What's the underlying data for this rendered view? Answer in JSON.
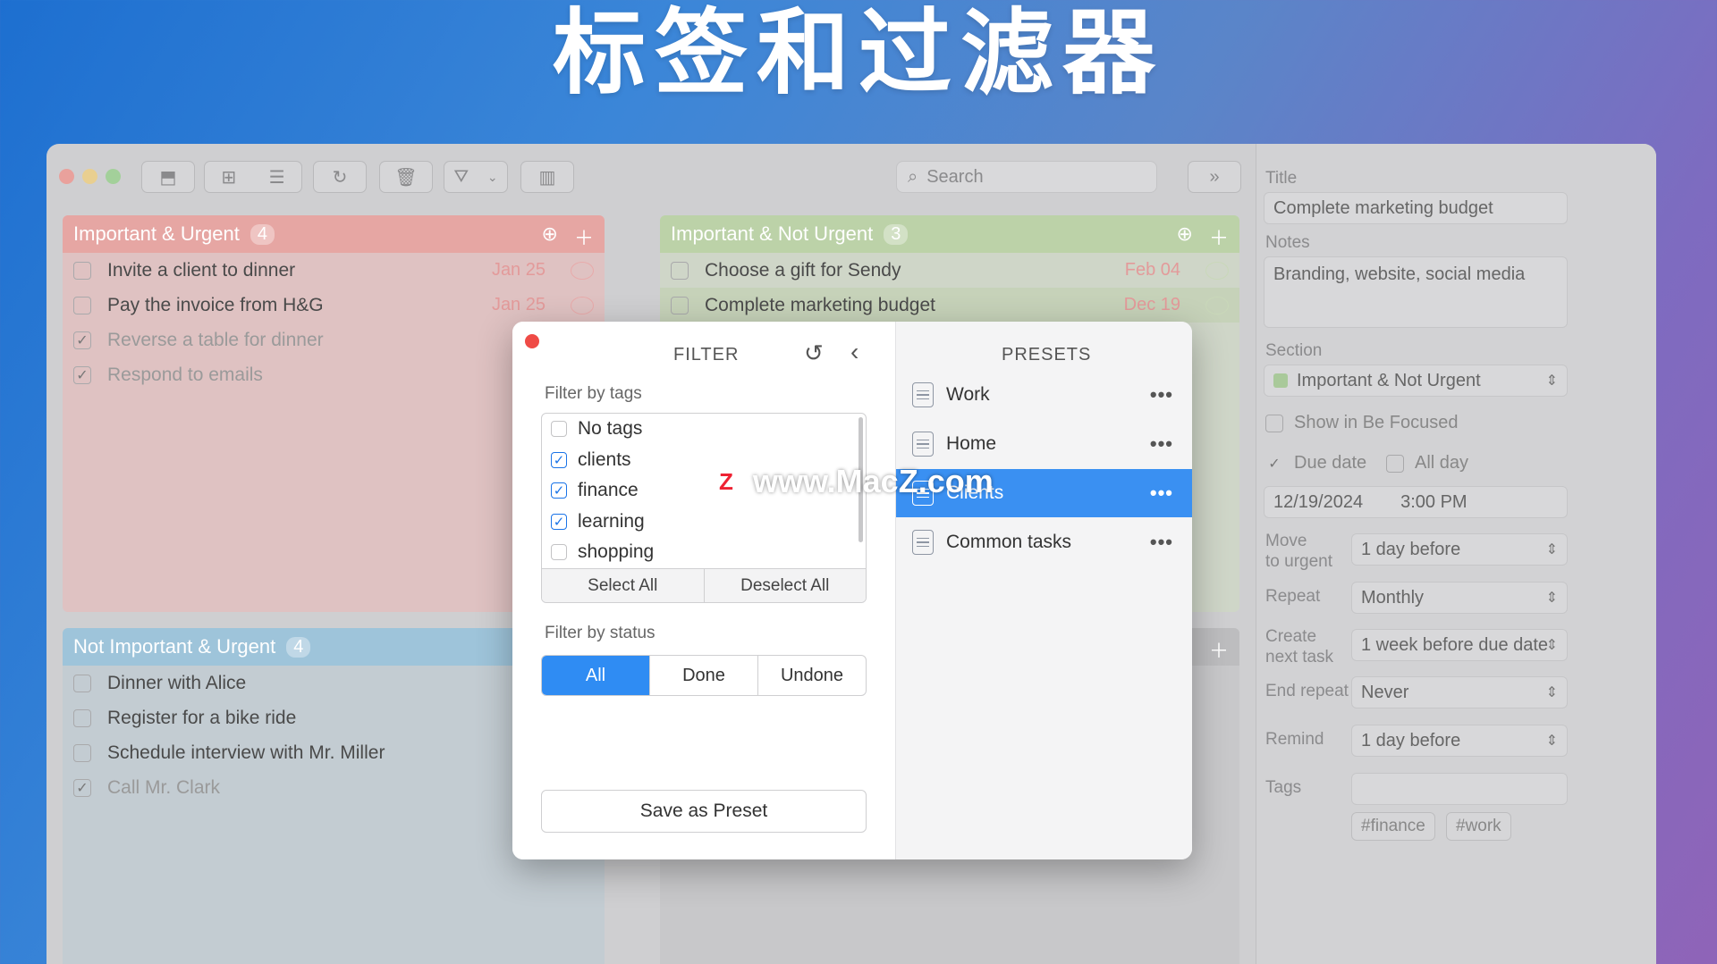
{
  "banner": {
    "title": "标签和过滤器"
  },
  "toolbar": {
    "search_placeholder": "Search"
  },
  "quadrants": {
    "q1": {
      "title": "Important & Urgent",
      "count": "4",
      "tasks": [
        {
          "label": "Invite a client to dinner",
          "due": "Jan 25",
          "done": false
        },
        {
          "label": "Pay the invoice from H&G",
          "due": "Jan 25",
          "done": false
        },
        {
          "label": "Reverse a table for dinner",
          "due": "",
          "done": true
        },
        {
          "label": "Respond to emails",
          "due": "",
          "done": true
        }
      ]
    },
    "q2": {
      "title": "Important & Not Urgent",
      "count": "3",
      "tasks": [
        {
          "label": "Choose a gift for Sendy",
          "due": "Feb 04",
          "done": false
        },
        {
          "label": "Complete marketing budget",
          "due": "Dec 19",
          "done": false
        }
      ]
    },
    "q3": {
      "title": "Not Important & Urgent",
      "count": "4",
      "tasks": [
        {
          "label": "Dinner with Alice",
          "done": false
        },
        {
          "label": "Register for a bike ride",
          "done": false
        },
        {
          "label": "Schedule interview with Mr. Miller",
          "done": false
        },
        {
          "label": "Call Mr. Clark",
          "done": true
        }
      ]
    }
  },
  "details": {
    "title_label": "Title",
    "title_value": "Complete marketing budget",
    "notes_label": "Notes",
    "notes_value": "Branding, website, social media",
    "section_label": "Section",
    "section_value": "Important & Not Urgent",
    "show_focused": "Show in Be Focused",
    "due_date": "Due date",
    "all_day": "All day",
    "date_value": "12/19/2024",
    "time_value": "3:00 PM",
    "move_label_1": "Move",
    "move_label_2": "to urgent",
    "move_value": "1 day before",
    "repeat_label": "Repeat",
    "repeat_value": "Monthly",
    "create_label_1": "Create",
    "create_label_2": "next task",
    "create_value": "1 week before due date",
    "end_label": "End repeat",
    "end_value": "Never",
    "remind_label": "Remind",
    "remind_value": "1 day before",
    "tags_label": "Tags",
    "tags": [
      "#finance",
      "#work"
    ]
  },
  "filter": {
    "title": "FILTER",
    "by_tags": "Filter by tags",
    "tags": [
      {
        "label": "No tags",
        "checked": false
      },
      {
        "label": "clients",
        "checked": true
      },
      {
        "label": "finance",
        "checked": true
      },
      {
        "label": "learning",
        "checked": true
      },
      {
        "label": "shopping",
        "checked": false
      }
    ],
    "select_all": "Select All",
    "deselect_all": "Deselect All",
    "by_status": "Filter by status",
    "status": [
      "All",
      "Done",
      "Undone"
    ],
    "save": "Save as Preset"
  },
  "presets": {
    "title": "PRESETS",
    "items": [
      "Work",
      "Home",
      "Clients",
      "Common tasks"
    ],
    "active": "Clients"
  },
  "watermark": "www.MacZ.com",
  "colors": {
    "accent": "#2f8cf3",
    "q1": "#e8a3a0",
    "q2": "#b9d0a5",
    "q3": "#9ec3d9",
    "banner": "#ffffff"
  }
}
